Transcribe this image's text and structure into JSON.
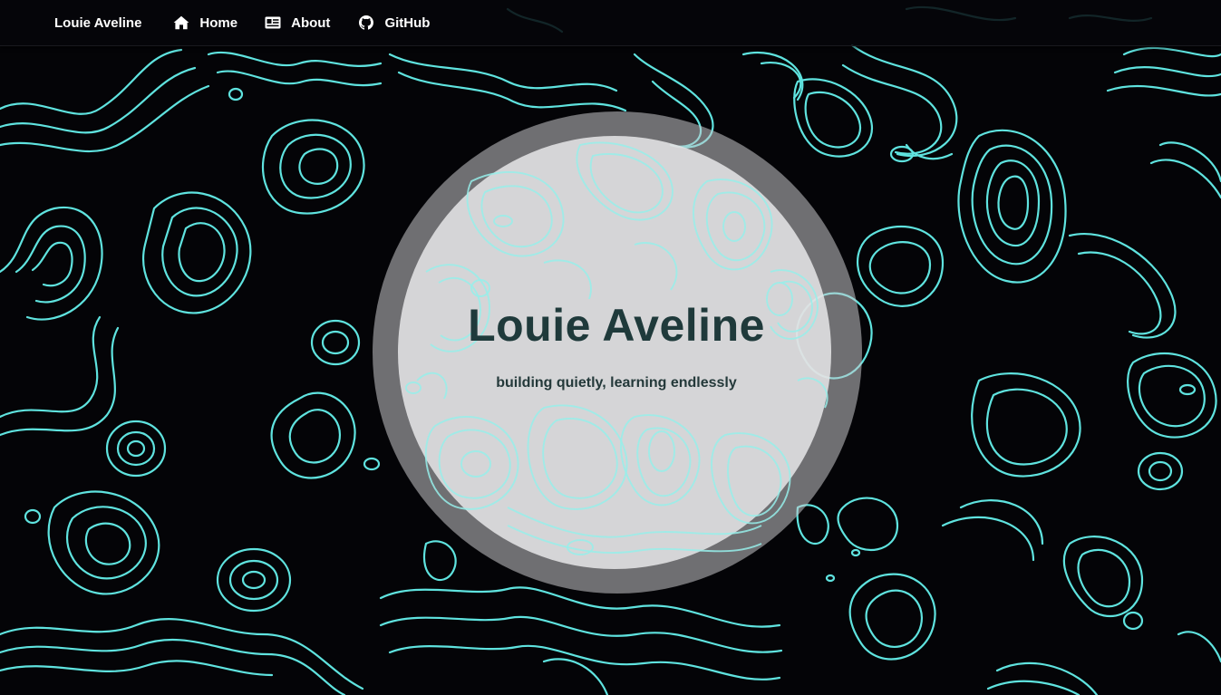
{
  "nav": {
    "brand": "Louie Aveline",
    "links": [
      {
        "label": "Home",
        "icon": "home-icon"
      },
      {
        "label": "About",
        "icon": "id-card-icon"
      },
      {
        "label": "GitHub",
        "icon": "github-icon"
      }
    ]
  },
  "hero": {
    "title": "Louie Aveline",
    "subtitle": "building quietly, learning endlessly"
  },
  "colors": {
    "background": "#040407",
    "contour_lines": "#5fe3df",
    "hero_disc": "#e4e4e5",
    "hero_text": "#1f3a3b"
  }
}
